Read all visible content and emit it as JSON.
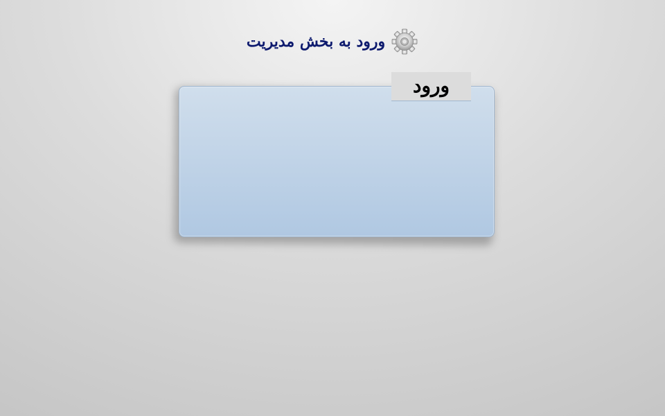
{
  "header": {
    "title": "ورود به بخش مدیریت",
    "icon": "gear-icon"
  },
  "login_panel": {
    "tab_label": "ورود"
  },
  "colors": {
    "title": "#0d1a6e",
    "panel_top": "#d0deec",
    "panel_bottom": "#b0c8e2",
    "panel_border": "#9fb6cf"
  }
}
